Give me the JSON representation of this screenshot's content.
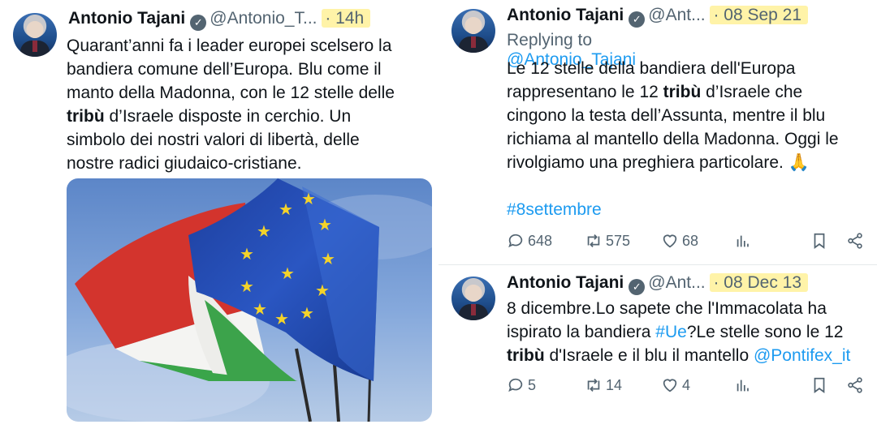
{
  "tweets": [
    {
      "name": "Antonio Tajani",
      "handle": "@Antonio_T...",
      "time": "· 14h",
      "text_parts": [
        "Quarant’anni fa i leader europei scelsero la",
        "bandiera comune dell’Europa. Blu come il",
        "manto della Madonna, con le 12 stelle delle",
        "tribù",
        " d’Israele disposte in cerchio. Un",
        "simbolo dei nostri valori di libertà, delle",
        "nostre radici giudaico-cristiane."
      ],
      "media": "flags-photo"
    },
    {
      "name": "Antonio Tajani",
      "handle": "@Ant...",
      "time": "· 08 Sep 21",
      "reply_prefix": "Replying to ",
      "reply_to": "@Antonio_Tajani",
      "text_parts": [
        "Le 12 stelle della bandiera dell'Europa",
        "rappresentano le 12 ",
        "tribù",
        " d’Israele che",
        "cingono la testa dell’Assunta, mentre il blu",
        "richiama al mantello della Madonna. Oggi le",
        "rivolgiamo una preghiera particolare. ",
        "🙏"
      ],
      "hashtag": "#8settembre",
      "replies": "648",
      "retweets": "575",
      "likes": "68"
    },
    {
      "name": "Antonio Tajani",
      "handle": "@Ant...",
      "time": "· 08 Dec 13",
      "text_parts": [
        "8 dicembre.Lo sapete che l'Immacolata ha",
        "ispirato la bandiera ",
        "#Ue",
        "?Le stelle sono le 12",
        "tribù",
        " d'Israele e il blu il mantello ",
        "@Pontifex_it"
      ],
      "replies": "5",
      "retweets": "14",
      "likes": "4"
    }
  ],
  "icons": {
    "reply": "speech-bubble-icon",
    "retweet": "retweet-icon",
    "like": "heart-icon",
    "views": "bar-chart-icon",
    "bookmark": "bookmark-icon",
    "share": "share-icon",
    "verified": "verified-badge-icon"
  },
  "colors": {
    "link": "#1d9bf0",
    "muted": "#536471",
    "highlight": "#fff3a8"
  }
}
